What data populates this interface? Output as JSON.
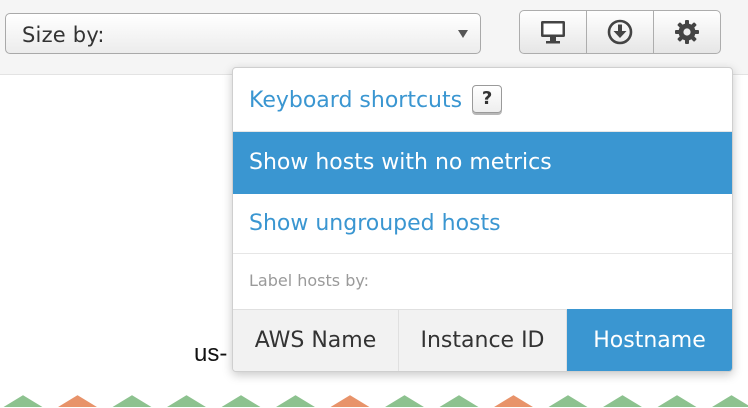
{
  "toolbar": {
    "size_by_label": "Size by:",
    "icons": [
      "monitor-icon",
      "download-icon",
      "gear-icon"
    ]
  },
  "menu": {
    "keyboard_shortcuts": "Keyboard shortcuts",
    "keyboard_key": "?",
    "show_no_metrics": "Show hosts with no metrics",
    "show_ungrouped": "Show ungrouped hosts",
    "label_hosts_by": "Label hosts by:",
    "label_options": [
      "AWS Name",
      "Instance ID",
      "Hostname"
    ],
    "label_selected": "Hostname",
    "highlighted_item": "Show hosts with no metrics"
  },
  "background": {
    "partial_label": "us-"
  },
  "colors": {
    "accent": "#3a96d1",
    "hex_green": "#8dc28f",
    "hex_orange": "#e8936a"
  }
}
